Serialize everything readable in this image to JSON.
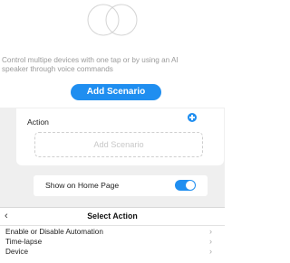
{
  "empty_state": {
    "line1": "Control multipe devices with one tap or by using an AI",
    "line2": "speaker through voice commands",
    "add_button": "Add Scenario"
  },
  "action_section": {
    "title": "Action",
    "placeholder": "Add Scenario"
  },
  "home_toggle": {
    "label": "Show on Home Page",
    "enabled": true
  },
  "select_action": {
    "back_icon": "chevron-left-icon",
    "title": "Select Action",
    "options": [
      {
        "label": "Enable or Disable Automation"
      },
      {
        "label": "Time-lapse"
      },
      {
        "label": "Device"
      }
    ]
  },
  "colors": {
    "accent": "#1f8ef0",
    "background_gray": "#efefef",
    "muted_text": "#9b9b9b"
  }
}
